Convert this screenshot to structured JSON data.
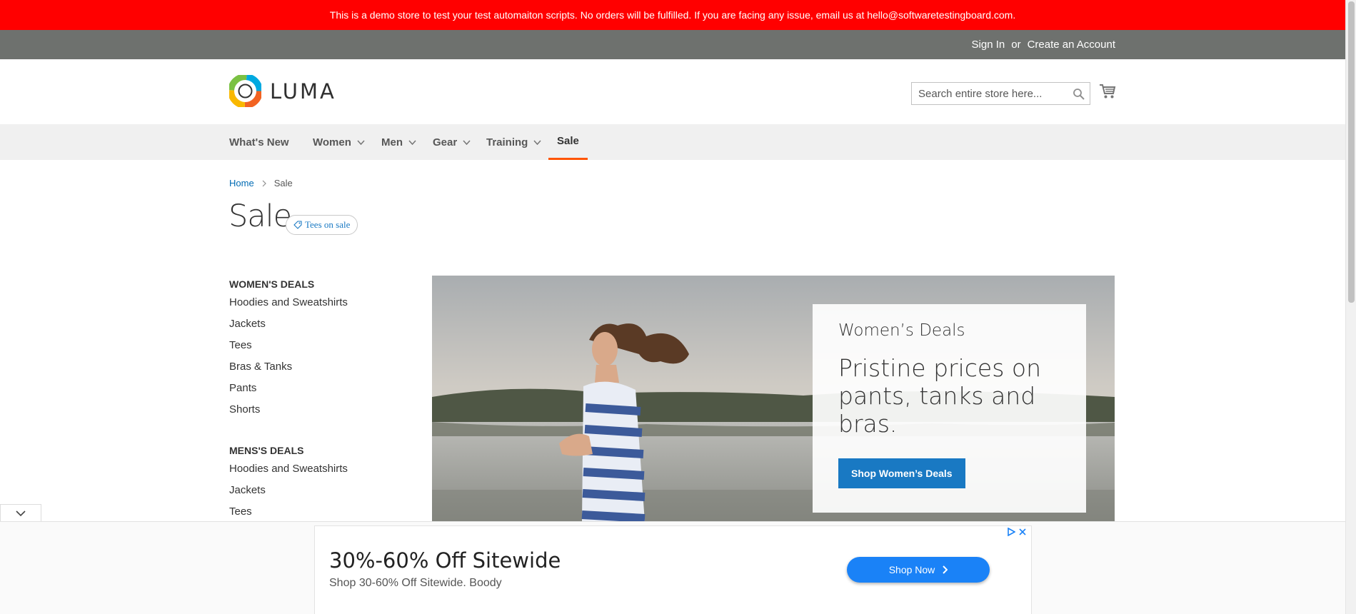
{
  "demo_banner": "This is a demo store to test your test automaiton scripts. No orders will be fulfilled. If you are facing any issue, email us at hello@softwaretestingboard.com.",
  "header_links": {
    "sign_in": "Sign In",
    "or": "or",
    "create_account": "Create an Account"
  },
  "logo": {
    "text": "LUMA",
    "icon": "luma-logo-icon"
  },
  "search": {
    "placeholder": "Search entire store here...",
    "value": ""
  },
  "nav": {
    "items": [
      {
        "label": "What's New",
        "has_dropdown": false
      },
      {
        "label": "Women",
        "has_dropdown": true
      },
      {
        "label": "Men",
        "has_dropdown": true
      },
      {
        "label": "Gear",
        "has_dropdown": true
      },
      {
        "label": "Training",
        "has_dropdown": true
      },
      {
        "label": "Sale",
        "has_dropdown": false,
        "active": true
      }
    ]
  },
  "breadcrumb": {
    "home": "Home",
    "current": "Sale"
  },
  "page": {
    "title": "Sale",
    "tag": "Tees on sale"
  },
  "sidebar": {
    "womens_title": "WOMEN'S DEALS",
    "womens_items": [
      "Hoodies and Sweatshirts",
      "Jackets",
      "Tees",
      "Bras & Tanks",
      "Pants",
      "Shorts"
    ],
    "mens_title": "MENS'S DEALS",
    "mens_items": [
      "Hoodies and Sweatshirts",
      "Jackets",
      "Tees"
    ]
  },
  "hero": {
    "subtitle": "Women’s Deals",
    "headline": "Pristine prices on pants, tanks and bras.",
    "button": "Shop Women’s Deals"
  },
  "ad": {
    "title": "30%-60% Off Sitewide",
    "description": "Shop 30-60% Off Sitewide. Boody",
    "button": "Shop Now"
  },
  "colors": {
    "demo_bar": "#ff0000",
    "header": "#6e716e",
    "link": "#006bb4",
    "primary_button": "#1979c3",
    "nav_active": "#ff5501",
    "ad_button": "#1a82f7"
  }
}
